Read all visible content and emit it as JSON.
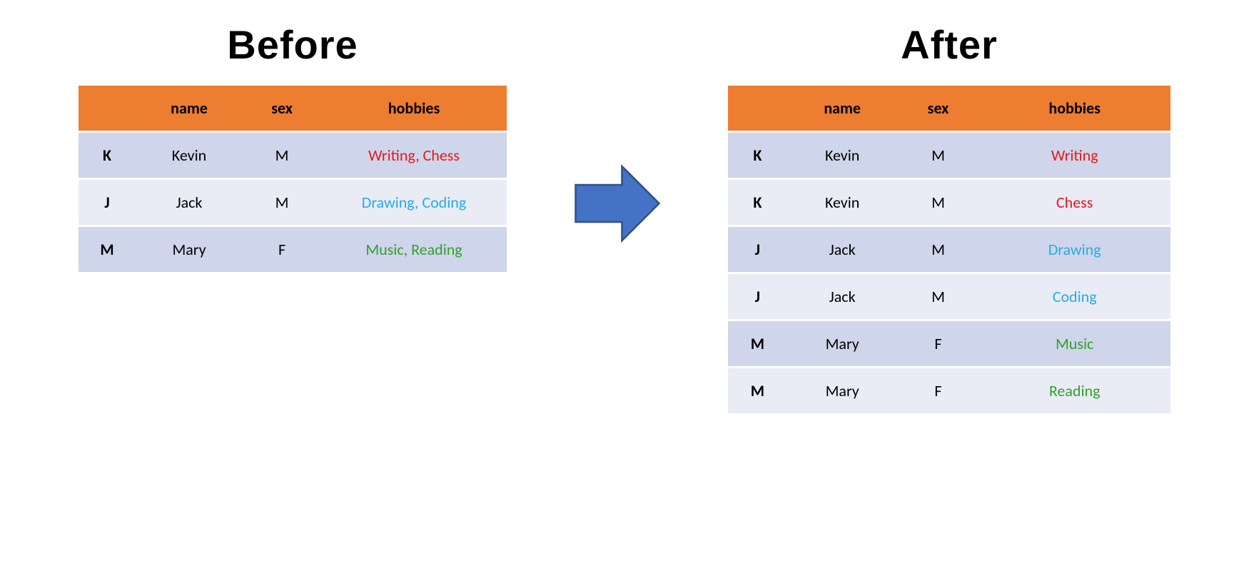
{
  "titles": {
    "before": "Before",
    "after": "After"
  },
  "columns": {
    "idx": "",
    "name": "name",
    "sex": "sex",
    "hobbies": "hobbies"
  },
  "colors": {
    "header_bg": "#ED7D31",
    "row_odd": "#CFD5EA",
    "row_even": "#E9EBF5",
    "red": "#E41A1C",
    "blue": "#29ABE2",
    "green": "#33A02C",
    "arrow": "#4472C4"
  },
  "before_rows": [
    {
      "idx": "K",
      "name": "Kevin",
      "sex": "M",
      "hobbies": "Writing, Chess",
      "color": "red"
    },
    {
      "idx": "J",
      "name": "Jack",
      "sex": "M",
      "hobbies": "Drawing, Coding",
      "color": "blue"
    },
    {
      "idx": "M",
      "name": "Mary",
      "sex": "F",
      "hobbies": "Music, Reading",
      "color": "green"
    }
  ],
  "after_rows": [
    {
      "idx": "K",
      "name": "Kevin",
      "sex": "M",
      "hobbies": "Writing",
      "color": "red"
    },
    {
      "idx": "K",
      "name": "Kevin",
      "sex": "M",
      "hobbies": "Chess",
      "color": "red"
    },
    {
      "idx": "J",
      "name": "Jack",
      "sex": "M",
      "hobbies": "Drawing",
      "color": "blue"
    },
    {
      "idx": "J",
      "name": "Jack",
      "sex": "M",
      "hobbies": "Coding",
      "color": "blue"
    },
    {
      "idx": "M",
      "name": "Mary",
      "sex": "F",
      "hobbies": "Music",
      "color": "green"
    },
    {
      "idx": "M",
      "name": "Mary",
      "sex": "F",
      "hobbies": "Reading",
      "color": "green"
    }
  ]
}
